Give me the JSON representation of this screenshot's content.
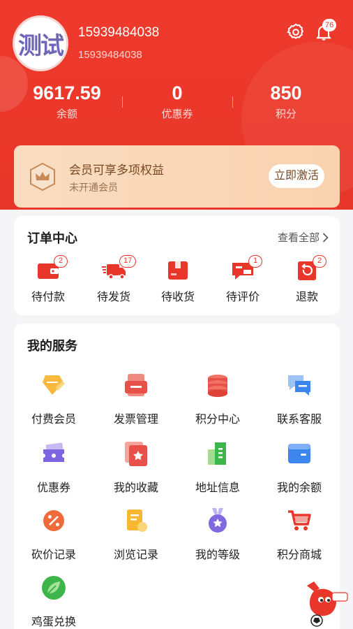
{
  "profile": {
    "avatar_text": "测试",
    "username": "15939484038",
    "phone": "15939484038",
    "notification_count": "76"
  },
  "stats": [
    {
      "value": "9617.59",
      "label": "余额"
    },
    {
      "value": "0",
      "label": "优惠券"
    },
    {
      "value": "850",
      "label": "积分"
    }
  ],
  "vip": {
    "title": "会员可享多项权益",
    "subtitle": "未开通会员",
    "button": "立即激活"
  },
  "orders": {
    "title": "订单中心",
    "view_all": "查看全部",
    "items": [
      {
        "label": "待付款",
        "icon": "wallet-icon",
        "badge": "2"
      },
      {
        "label": "待发货",
        "icon": "truck-icon",
        "badge": "17"
      },
      {
        "label": "待收货",
        "icon": "package-icon",
        "badge": ""
      },
      {
        "label": "待评价",
        "icon": "review-icon",
        "badge": "1"
      },
      {
        "label": "退款",
        "icon": "refund-icon",
        "badge": "2"
      }
    ]
  },
  "services": {
    "title": "我的服务",
    "items": [
      {
        "label": "付费会员",
        "icon": "diamond-icon"
      },
      {
        "label": "发票管理",
        "icon": "invoice-icon"
      },
      {
        "label": "积分中心",
        "icon": "coins-icon"
      },
      {
        "label": "联系客服",
        "icon": "chat-icon"
      },
      {
        "label": "优惠券",
        "icon": "ticket-icon"
      },
      {
        "label": "我的收藏",
        "icon": "star-card-icon"
      },
      {
        "label": "地址信息",
        "icon": "building-icon"
      },
      {
        "label": "我的余额",
        "icon": "wallet-card-icon"
      },
      {
        "label": "砍价记录",
        "icon": "discount-icon"
      },
      {
        "label": "浏览记录",
        "icon": "history-doc-icon"
      },
      {
        "label": "我的等级",
        "icon": "medal-icon"
      },
      {
        "label": "积分商城",
        "icon": "cart-icon"
      },
      {
        "label": "鸡蛋兑换",
        "icon": "leaf-icon"
      }
    ]
  },
  "colors": {
    "brand": "#e8362a",
    "vip_text": "#7a4a23"
  }
}
